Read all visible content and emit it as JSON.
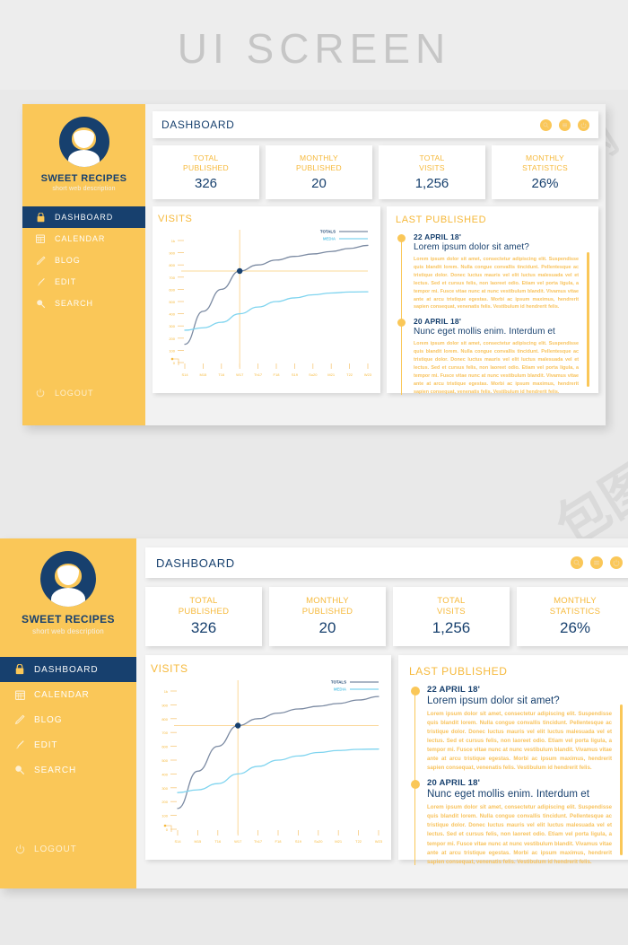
{
  "banner": {
    "title": "UI SCREEN"
  },
  "watermarks": [
    "包图网",
    "包图网",
    "包图网",
    "包图网",
    "包图网",
    "包图网",
    "包图网"
  ],
  "colors": {
    "sidebar_yellow": "#fac758",
    "accent_yellow": "#f6b93b",
    "navy": "#17406e",
    "media_blue": "#7fd4ef",
    "totals_gray": "#7b8aa2",
    "page_bg": "#e9e9e9",
    "card_bg": "#ffffff"
  },
  "sidebar": {
    "brand_name": "SWEET RECIPES",
    "brand_desc": "short web description",
    "avatar_icon": "user-avatar-icon",
    "items": [
      {
        "label": "DASHBOARD",
        "icon": "lock-icon",
        "active": true
      },
      {
        "label": "CALENDAR",
        "icon": "calendar-icon",
        "active": false
      },
      {
        "label": "BLOG",
        "icon": "pencil-icon",
        "active": false
      },
      {
        "label": "EDIT",
        "icon": "brush-icon",
        "active": false
      },
      {
        "label": "SEARCH",
        "icon": "magnifier-icon",
        "active": false
      }
    ],
    "logout": {
      "label": "LOGOUT",
      "icon": "power-icon"
    }
  },
  "topbar": {
    "title": "DASHBOARD",
    "actions": [
      {
        "icon": "search-icon",
        "name": "search-button"
      },
      {
        "icon": "menu-icon",
        "name": "menu-button"
      },
      {
        "icon": "power-icon",
        "name": "power-button"
      }
    ]
  },
  "stats": [
    {
      "label": "TOTAL PUBLISHED",
      "label_line1": "TOTAL",
      "label_line2": "PUBLISHED",
      "value": "326"
    },
    {
      "label": "MONTHLY PUBLISHED",
      "label_line1": "MONTHLY",
      "label_line2": "PUBLISHED",
      "value": "20"
    },
    {
      "label": "TOTAL VISITS",
      "label_line1": "TOTAL",
      "label_line2": "VISITS",
      "value": "1,256"
    },
    {
      "label": "MONTHLY STATISTICS",
      "label_line1": "MONTHLY",
      "label_line2": "STATISTICS",
      "value": "26%"
    }
  ],
  "chart_card": {
    "heading": "VISITS"
  },
  "chart_data": {
    "type": "line",
    "title": "VISITS",
    "xlabel": "",
    "ylabel": "",
    "x": [
      "S14",
      "M15",
      "T16",
      "W17",
      "Th17",
      "F18",
      "S19",
      "Su20",
      "M21",
      "T22",
      "W23"
    ],
    "ytick_labels": [
      "0",
      "100",
      "200",
      "300",
      "400",
      "500",
      "600",
      "700",
      "800",
      "900",
      "1k"
    ],
    "ylim": [
      0,
      1000
    ],
    "grid": false,
    "legend_position": "top-right",
    "highlight_point": {
      "x": "W17",
      "y": 750,
      "color": "#17406e"
    },
    "crosshair": {
      "x": "W17",
      "y": 750,
      "color": "#fbd89a"
    },
    "series": [
      {
        "name": "TOTALS",
        "color": "#7b8aa2",
        "values": [
          150,
          420,
          600,
          750,
          800,
          840,
          870,
          890,
          910,
          935,
          960
        ]
      },
      {
        "name": "MEDIA",
        "color": "#7fd4ef",
        "values": [
          265,
          285,
          330,
          400,
          455,
          500,
          530,
          555,
          570,
          578,
          580
        ]
      }
    ]
  },
  "published_card": {
    "heading": "LAST PUBLISHED",
    "items": [
      {
        "date": "22 APRIL 18'",
        "title": "Lorem ipsum dolor sit amet?",
        "body": "Lorem ipsum dolor sit amet, consectetur adipiscing elit. Suspendisse quis blandit lorem. Nulla congue convallis tincidunt. Pellentesque ac tristique dolor. Donec luctus mauris vel elit luctus malesuada vel et lectus. Sed et cursus felis, non laoreet odio. Etiam vel porta ligula, a tempor mi. Fusce vitae nunc at nunc vestibulum blandit. Vivamus vitae ante at arcu tristique egestas. Morbi ac ipsum maximus, hendrerit sapien consequat, venenatis felis. Vestibulum id hendrerit felis."
      },
      {
        "date": "20 APRIL 18'",
        "title": "Nunc eget mollis enim. Interdum et",
        "body": "Lorem ipsum dolor sit amet, consectetur adipiscing elit. Suspendisse quis blandit lorem. Nulla congue convallis tincidunt. Pellentesque ac tristique dolor. Donec luctus mauris vel elit luctus malesuada vel et lectus. Sed et cursus felis, non laoreet odio. Etiam vel porta ligula, a tempor mi. Fusce vitae nunc at nunc vestibulum blandit. Vivamus vitae ante at arcu tristique egestas. Morbi ac ipsum maximus, hendrerit sapien consequat, venenatis felis. Vestibulum id hendrerit felis."
      }
    ]
  }
}
